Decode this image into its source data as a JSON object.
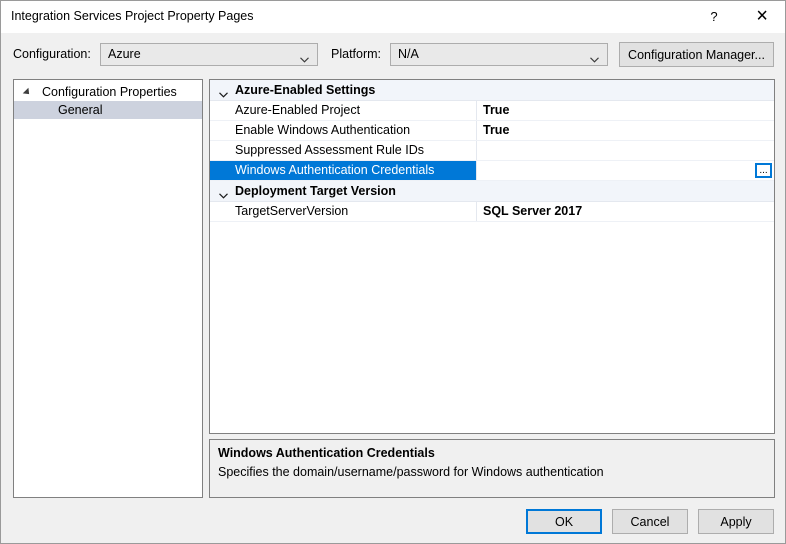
{
  "window": {
    "title": "Integration Services Project Property Pages",
    "help_label": "?",
    "close_label": "✕"
  },
  "toolbar": {
    "configuration_label": "Configuration:",
    "configuration_value": "Azure",
    "platform_label": "Platform:",
    "platform_value": "N/A",
    "configuration_manager_label": "Configuration Manager..."
  },
  "tree": {
    "root_label": "Configuration Properties",
    "child_label": "General"
  },
  "grid": {
    "categories": [
      {
        "label": "Azure-Enabled Settings",
        "expanded": true,
        "properties": [
          {
            "name": "Azure-Enabled Project",
            "value": "True",
            "selected": false,
            "has_ellipsis": false
          },
          {
            "name": "Enable Windows Authentication",
            "value": "True",
            "selected": false,
            "has_ellipsis": false
          },
          {
            "name": "Suppressed Assessment Rule IDs",
            "value": "",
            "selected": false,
            "has_ellipsis": false
          },
          {
            "name": "Windows Authentication Credentials",
            "value": "",
            "selected": true,
            "has_ellipsis": true
          }
        ]
      },
      {
        "label": "Deployment Target Version",
        "expanded": true,
        "properties": [
          {
            "name": "TargetServerVersion",
            "value": "SQL Server 2017",
            "selected": false,
            "has_ellipsis": false
          }
        ]
      }
    ],
    "ellipsis_label": "..."
  },
  "description": {
    "title": "Windows Authentication Credentials",
    "text": "Specifies the domain/username/password for Windows authentication"
  },
  "footer": {
    "ok_label": "OK",
    "cancel_label": "Cancel",
    "apply_label": "Apply"
  },
  "colors": {
    "selection_blue": "#0078d7",
    "dialog_background": "#f0f0f0",
    "tree_selection": "#cdd2de",
    "category_background": "#f2f5fa"
  }
}
